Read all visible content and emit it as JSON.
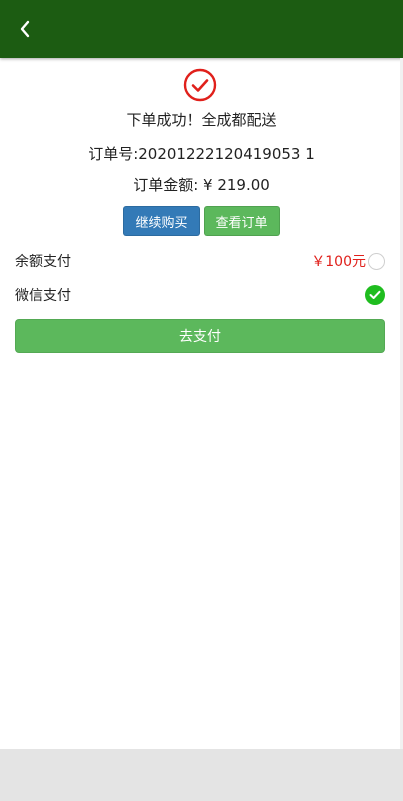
{
  "colors": {
    "header_bg": "#1c5c12",
    "success_icon": "#e0201b",
    "primary_button": "#337ab7",
    "success_button": "#5cb85c",
    "amount_red": "#e0201b",
    "checked_green": "#1fbd1f",
    "footer_gray": "#e4e4e4"
  },
  "header": {
    "back_icon": "chevron-left-icon"
  },
  "order": {
    "status_icon": "check-circle-icon",
    "success_message": "下单成功！全成都配送",
    "order_number": "订单号:20201222120419053 1",
    "order_amount": "订单金额: ¥  219.00"
  },
  "actions": {
    "continue_shopping": "继续购买",
    "view_order": "查看订单"
  },
  "payment": {
    "balance": {
      "label": "余额支付",
      "amount": "￥100元",
      "selected": false
    },
    "wechat": {
      "label": "微信支付",
      "selected": true
    },
    "pay_button": "去支付"
  }
}
